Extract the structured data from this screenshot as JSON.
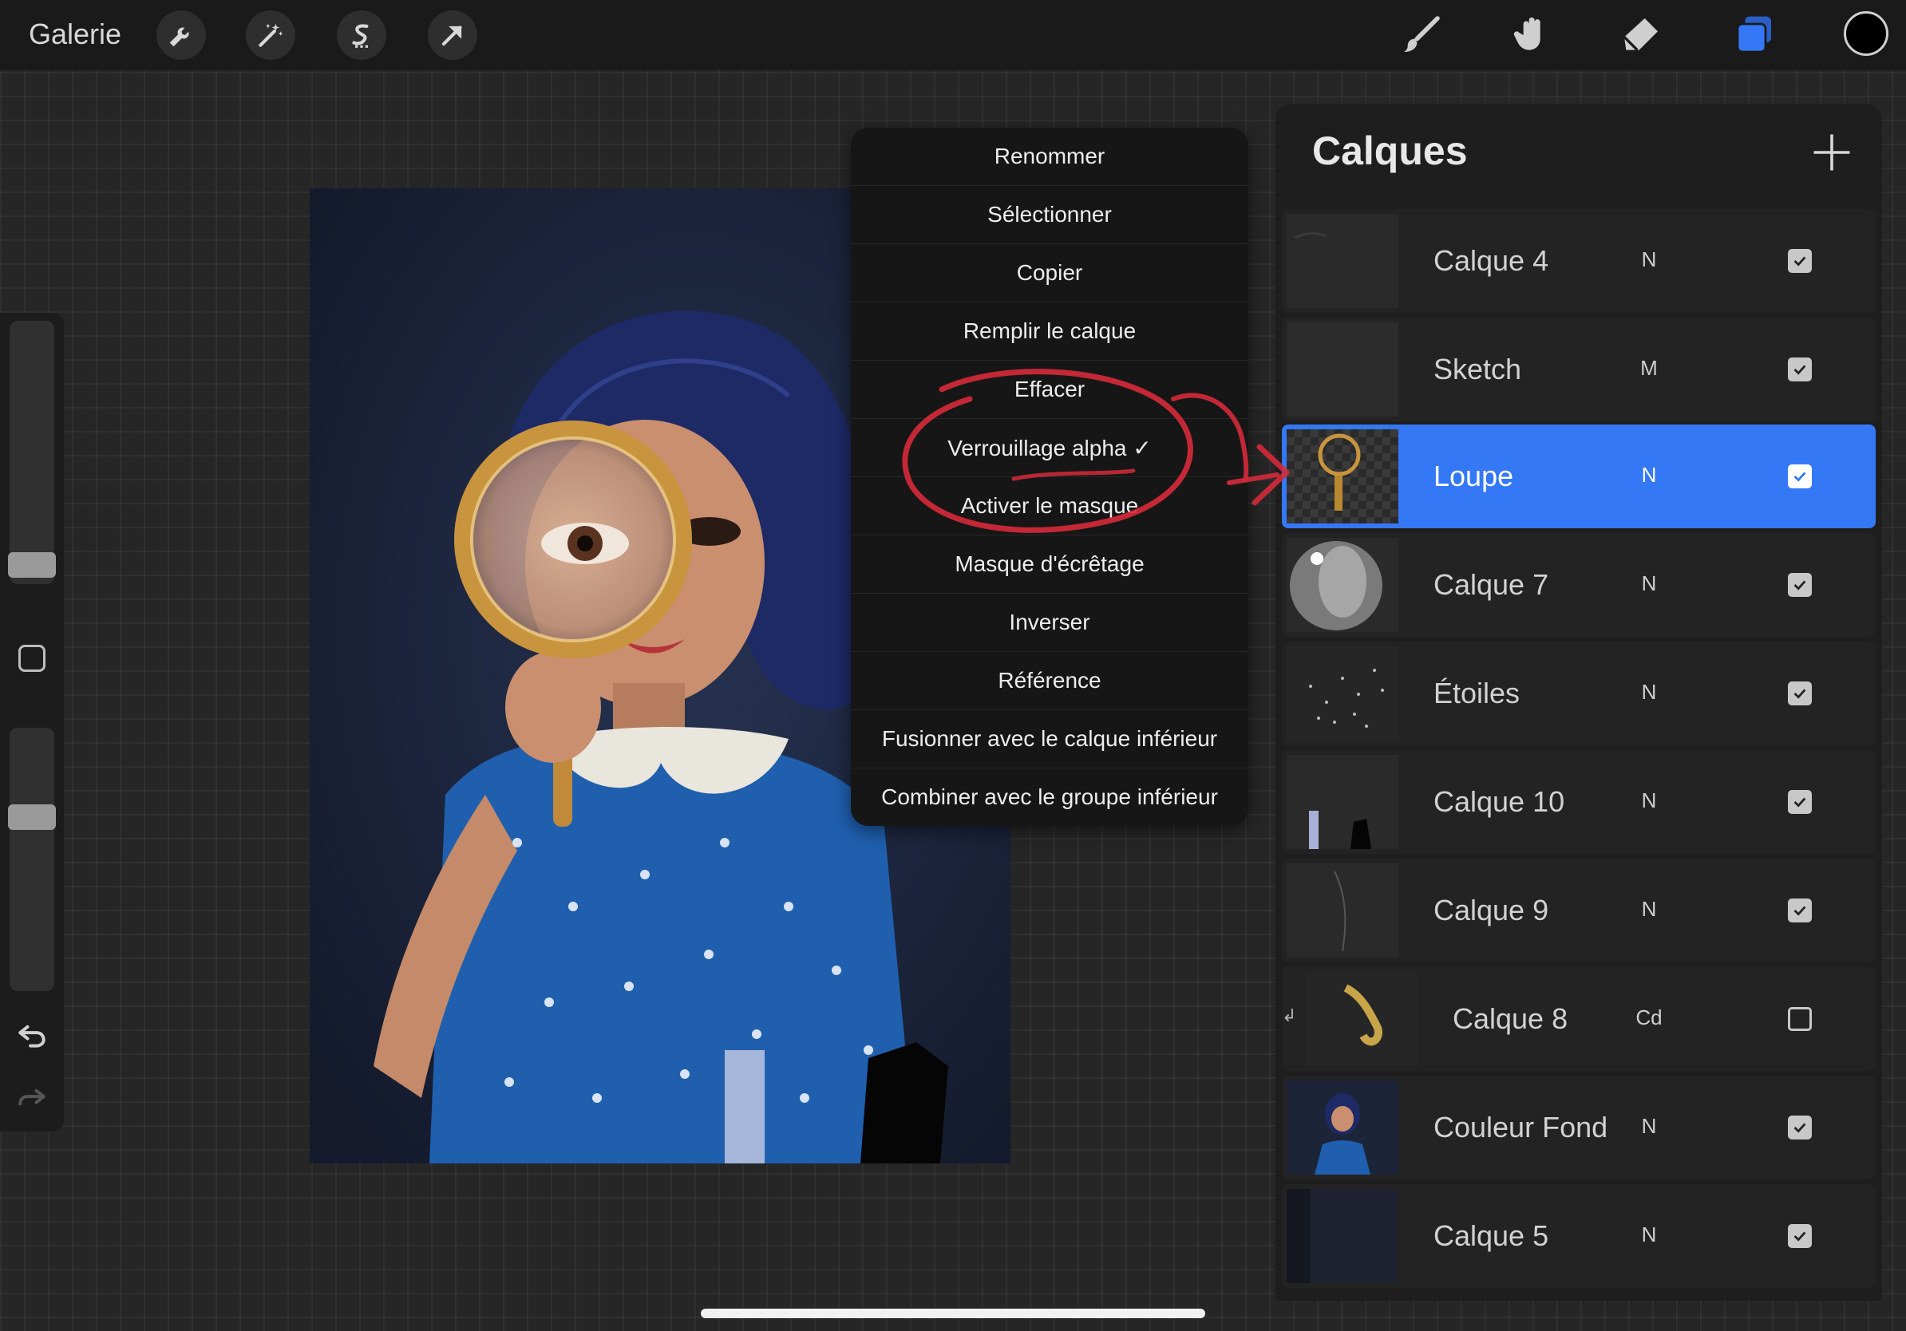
{
  "topbar": {
    "gallery_label": "Galerie",
    "left_tools": [
      "wrench-icon",
      "magic-wand-icon",
      "selection-s-icon",
      "transform-arrow-icon"
    ],
    "right_tools": [
      "brush-icon",
      "smudge-icon",
      "eraser-icon",
      "layers-icon"
    ],
    "current_color": "#000000",
    "active_tool_color": "#3478f6"
  },
  "sidebar": {
    "brush_size_level": 0.3,
    "opacity_level": 0.3,
    "items": [
      "brush-size-slider",
      "modify-button",
      "opacity-slider",
      "undo-icon",
      "redo-icon"
    ]
  },
  "context_menu": {
    "items": [
      "Renommer",
      "Sélectionner",
      "Copier",
      "Remplir le calque",
      "Effacer",
      "Verrouillage alpha ✓",
      "Activer le masque",
      "Masque d'écrêtage",
      "Inverser",
      "Référence",
      "Fusionner avec le calque inférieur",
      "Combiner avec le groupe inférieur"
    ],
    "annotation_color": "#d42a3a"
  },
  "layers_panel": {
    "title": "Calques",
    "layers": [
      {
        "name": "Calque 4",
        "blend": "N",
        "visible": true,
        "active": false,
        "clipped": false
      },
      {
        "name": "Sketch",
        "blend": "M",
        "visible": true,
        "active": false,
        "clipped": false
      },
      {
        "name": "Loupe",
        "blend": "N",
        "visible": true,
        "active": true,
        "clipped": false
      },
      {
        "name": "Calque 7",
        "blend": "N",
        "visible": true,
        "active": false,
        "clipped": false
      },
      {
        "name": "Étoiles",
        "blend": "N",
        "visible": true,
        "active": false,
        "clipped": false
      },
      {
        "name": "Calque 10",
        "blend": "N",
        "visible": true,
        "active": false,
        "clipped": false
      },
      {
        "name": "Calque 9",
        "blend": "N",
        "visible": true,
        "active": false,
        "clipped": false
      },
      {
        "name": "Calque 8",
        "blend": "Cd",
        "visible": false,
        "active": false,
        "clipped": true
      },
      {
        "name": "Couleur Fond",
        "blend": "N",
        "visible": true,
        "active": false,
        "clipped": false
      },
      {
        "name": "Calque 5",
        "blend": "N",
        "visible": true,
        "active": false,
        "clipped": false
      }
    ]
  }
}
